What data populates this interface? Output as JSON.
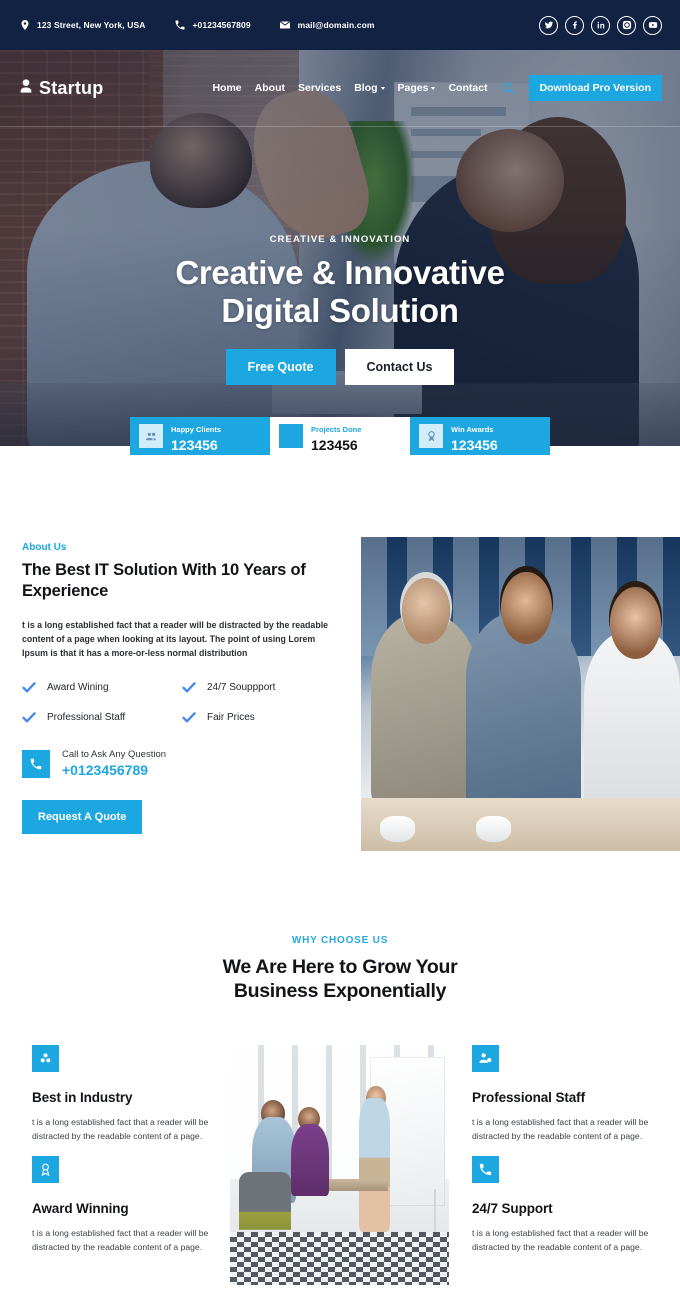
{
  "topbar": {
    "address": "123 Street, New York, USA",
    "phone": "+01234567809",
    "email": "mail@domain.com",
    "socials": [
      "twitter-icon",
      "facebook-icon",
      "linkedin-icon",
      "instagram-icon",
      "youtube-icon"
    ]
  },
  "nav": {
    "brand": "Startup",
    "menu": [
      {
        "label": "Home",
        "caret": false
      },
      {
        "label": "About",
        "caret": false
      },
      {
        "label": "Services",
        "caret": false
      },
      {
        "label": "Blog",
        "caret": true
      },
      {
        "label": "Pages",
        "caret": true
      },
      {
        "label": "Contact",
        "caret": false
      }
    ],
    "search_icon": "search-icon",
    "pro_button": "Download Pro Version"
  },
  "hero": {
    "eyebrow": "CREATIVE & INNOVATION",
    "title_line1": "Creative & Innovative",
    "title_line2": "Digital Solution",
    "primary_button": "Free Quote",
    "secondary_button": "Contact Us"
  },
  "stats": [
    {
      "label": "Happy Clients",
      "value": "123456",
      "icon": "group-icon"
    },
    {
      "label": "Projects Done",
      "value": "123456",
      "icon": "projects-icon"
    },
    {
      "label": "Win Awards",
      "value": "123456",
      "icon": "award-icon"
    }
  ],
  "about": {
    "kicker": "About Us",
    "title": "The Best IT Solution With 10 Years of Experience",
    "paragraph": "t is a long established fact that a reader will be distracted by the readable content of a page when looking at its layout. The point of using Lorem Ipsum is that it has a more-or-less normal distribution",
    "checks": [
      "Award Wining",
      "24/7 Souppport",
      "Professional Staff",
      "Fair Prices"
    ],
    "call_label": "Call to Ask Any Question",
    "call_number": "+0123456789",
    "quote_button": "Request A Quote"
  },
  "why": {
    "kicker": "WHY CHOOSE US",
    "title_line1": "We Are Here to Grow Your",
    "title_line2": "Business Exponentially",
    "features": [
      {
        "title": "Best in Industry",
        "text": "t is a long established fact that a reader will be distracted by the readable content of a page.",
        "icon": "cubes-icon"
      },
      {
        "title": "Award Winning",
        "text": "t is a long established fact that a reader will be distracted by the readable content of a page.",
        "icon": "award-icon"
      },
      {
        "title": "Professional Staff",
        "text": "t is a long established fact that a reader will be distracted by the readable content of a page.",
        "icon": "user-gear-icon"
      },
      {
        "title": "24/7 Support",
        "text": "t is a long established fact that a reader will be distracted by the readable content of a page.",
        "icon": "phone-icon"
      }
    ]
  },
  "colors": {
    "accent": "#1CA7E0",
    "dark_navy": "#122242",
    "heading": "#12141A",
    "check_blue": "#4285F4"
  }
}
